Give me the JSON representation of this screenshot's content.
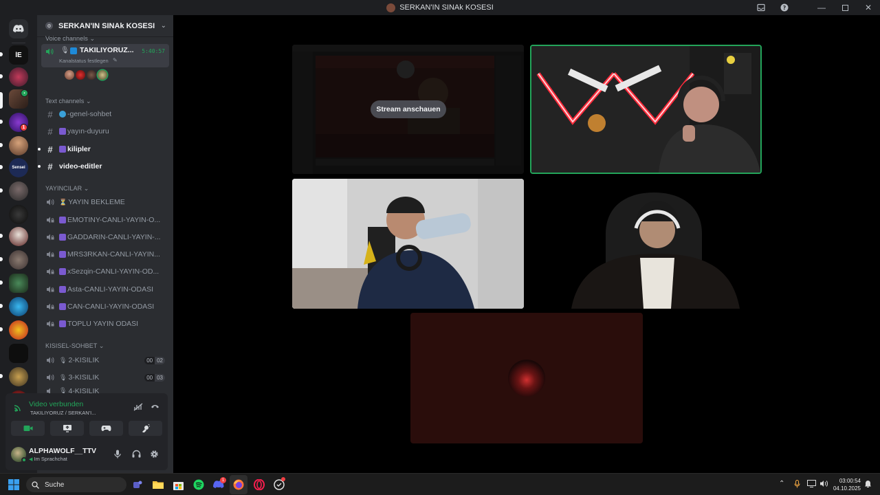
{
  "window": {
    "title": "SERKAN'IN SINAk KOSESI"
  },
  "guild": {
    "name": "SERKAN'IN SINAk KOSESI"
  },
  "server_rail": {
    "badges": [
      "1"
    ]
  },
  "voice_channels": {
    "category": "Voice channels",
    "active": {
      "name": "TAKILIYORUZ...",
      "timer": "5:40:57",
      "status": "Kanalstatus festlegen"
    }
  },
  "text_channels": {
    "category": "Text channels",
    "items": [
      {
        "label": "-genel-sohbet"
      },
      {
        "label": "yayın-duyuru"
      },
      {
        "label": "kilipler"
      },
      {
        "label": "video-editler"
      }
    ]
  },
  "yayincilar": {
    "category": "YAYINCILAR",
    "items": [
      {
        "label": "YAYIN BEKLEME"
      },
      {
        "label": "EMOTINY-CANLI-YAYIN-O..."
      },
      {
        "label": "GADDARIN-CANLI-YAYIN-..."
      },
      {
        "label": "MRS3RKAN-CANLI-YAYIN..."
      },
      {
        "label": "xSezqin-CANLI-YAYIN-OD..."
      },
      {
        "label": "Asta-CANLI-YAYIN-ODASI"
      },
      {
        "label": "CAN-CANLI-YAYIN-ODASI"
      },
      {
        "label": "TOPLU YAYIN ODASI"
      }
    ]
  },
  "kisisel": {
    "category": "KISISEL-SOHBET",
    "items": [
      {
        "label": "2-KISILIK",
        "count_a": "00",
        "count_b": "02"
      },
      {
        "label": "3-KISILIK",
        "count_a": "00",
        "count_b": "03"
      },
      {
        "label": "4-KISILIK"
      }
    ]
  },
  "voice_panel": {
    "status": "Video verbunden",
    "channel": "TAKILIYORUZ / SERKAN'I..."
  },
  "user": {
    "name": "ALPHAWOLF__TTV",
    "status": "Im Sprachchat"
  },
  "stage": {
    "stream_button": "Stream anschauen"
  },
  "taskbar": {
    "search_label": "Suche",
    "time": "03:00:54",
    "date": "04.10.2025",
    "badges": [
      "1"
    ]
  },
  "colors": {
    "speaking_border": "#23a55a",
    "online": "#23a55a",
    "unread_badge": "#f23f43"
  }
}
